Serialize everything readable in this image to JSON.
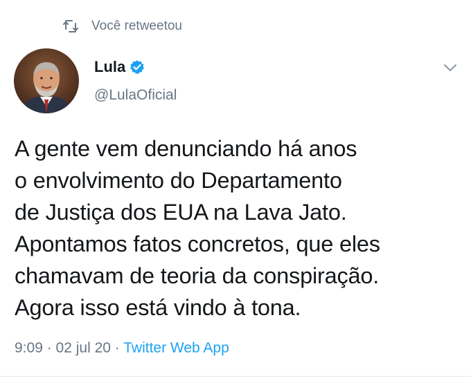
{
  "retweet": {
    "icon": "retweet-icon",
    "label": "Você retweetou"
  },
  "author": {
    "name": "Lula",
    "handle": "@LulaOficial",
    "verified": true,
    "verified_color": "#1da1f2"
  },
  "tweet": {
    "lines": [
      "A gente vem denunciando há anos",
      "o envolvimento do Departamento",
      "de Justiça dos EUA na Lava Jato.",
      "Apontamos fatos concretos, que eles",
      "chamavam de teoria da conspiração.",
      "Agora isso está vindo à tona."
    ]
  },
  "meta": {
    "time": "9:09",
    "separator1": " · ",
    "date": "02 jul 20",
    "separator2": " · ",
    "source": "Twitter Web App"
  },
  "colors": {
    "secondary_text": "#687684",
    "primary_text": "#14171a",
    "link": "#1da1f2"
  }
}
